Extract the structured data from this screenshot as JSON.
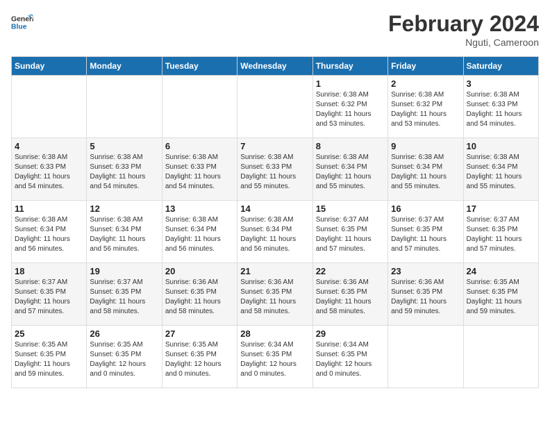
{
  "header": {
    "logo_line1": "General",
    "logo_line2": "Blue",
    "title": "February 2024",
    "subtitle": "Nguti, Cameroon"
  },
  "days_of_week": [
    "Sunday",
    "Monday",
    "Tuesday",
    "Wednesday",
    "Thursday",
    "Friday",
    "Saturday"
  ],
  "weeks": [
    [
      {
        "day": "",
        "info": ""
      },
      {
        "day": "",
        "info": ""
      },
      {
        "day": "",
        "info": ""
      },
      {
        "day": "",
        "info": ""
      },
      {
        "day": "1",
        "info": "Sunrise: 6:38 AM\nSunset: 6:32 PM\nDaylight: 11 hours\nand 53 minutes."
      },
      {
        "day": "2",
        "info": "Sunrise: 6:38 AM\nSunset: 6:32 PM\nDaylight: 11 hours\nand 53 minutes."
      },
      {
        "day": "3",
        "info": "Sunrise: 6:38 AM\nSunset: 6:33 PM\nDaylight: 11 hours\nand 54 minutes."
      }
    ],
    [
      {
        "day": "4",
        "info": "Sunrise: 6:38 AM\nSunset: 6:33 PM\nDaylight: 11 hours\nand 54 minutes."
      },
      {
        "day": "5",
        "info": "Sunrise: 6:38 AM\nSunset: 6:33 PM\nDaylight: 11 hours\nand 54 minutes."
      },
      {
        "day": "6",
        "info": "Sunrise: 6:38 AM\nSunset: 6:33 PM\nDaylight: 11 hours\nand 54 minutes."
      },
      {
        "day": "7",
        "info": "Sunrise: 6:38 AM\nSunset: 6:33 PM\nDaylight: 11 hours\nand 55 minutes."
      },
      {
        "day": "8",
        "info": "Sunrise: 6:38 AM\nSunset: 6:34 PM\nDaylight: 11 hours\nand 55 minutes."
      },
      {
        "day": "9",
        "info": "Sunrise: 6:38 AM\nSunset: 6:34 PM\nDaylight: 11 hours\nand 55 minutes."
      },
      {
        "day": "10",
        "info": "Sunrise: 6:38 AM\nSunset: 6:34 PM\nDaylight: 11 hours\nand 55 minutes."
      }
    ],
    [
      {
        "day": "11",
        "info": "Sunrise: 6:38 AM\nSunset: 6:34 PM\nDaylight: 11 hours\nand 56 minutes."
      },
      {
        "day": "12",
        "info": "Sunrise: 6:38 AM\nSunset: 6:34 PM\nDaylight: 11 hours\nand 56 minutes."
      },
      {
        "day": "13",
        "info": "Sunrise: 6:38 AM\nSunset: 6:34 PM\nDaylight: 11 hours\nand 56 minutes."
      },
      {
        "day": "14",
        "info": "Sunrise: 6:38 AM\nSunset: 6:34 PM\nDaylight: 11 hours\nand 56 minutes."
      },
      {
        "day": "15",
        "info": "Sunrise: 6:37 AM\nSunset: 6:35 PM\nDaylight: 11 hours\nand 57 minutes."
      },
      {
        "day": "16",
        "info": "Sunrise: 6:37 AM\nSunset: 6:35 PM\nDaylight: 11 hours\nand 57 minutes."
      },
      {
        "day": "17",
        "info": "Sunrise: 6:37 AM\nSunset: 6:35 PM\nDaylight: 11 hours\nand 57 minutes."
      }
    ],
    [
      {
        "day": "18",
        "info": "Sunrise: 6:37 AM\nSunset: 6:35 PM\nDaylight: 11 hours\nand 57 minutes."
      },
      {
        "day": "19",
        "info": "Sunrise: 6:37 AM\nSunset: 6:35 PM\nDaylight: 11 hours\nand 58 minutes."
      },
      {
        "day": "20",
        "info": "Sunrise: 6:36 AM\nSunset: 6:35 PM\nDaylight: 11 hours\nand 58 minutes."
      },
      {
        "day": "21",
        "info": "Sunrise: 6:36 AM\nSunset: 6:35 PM\nDaylight: 11 hours\nand 58 minutes."
      },
      {
        "day": "22",
        "info": "Sunrise: 6:36 AM\nSunset: 6:35 PM\nDaylight: 11 hours\nand 58 minutes."
      },
      {
        "day": "23",
        "info": "Sunrise: 6:36 AM\nSunset: 6:35 PM\nDaylight: 11 hours\nand 59 minutes."
      },
      {
        "day": "24",
        "info": "Sunrise: 6:35 AM\nSunset: 6:35 PM\nDaylight: 11 hours\nand 59 minutes."
      }
    ],
    [
      {
        "day": "25",
        "info": "Sunrise: 6:35 AM\nSunset: 6:35 PM\nDaylight: 11 hours\nand 59 minutes."
      },
      {
        "day": "26",
        "info": "Sunrise: 6:35 AM\nSunset: 6:35 PM\nDaylight: 12 hours\nand 0 minutes."
      },
      {
        "day": "27",
        "info": "Sunrise: 6:35 AM\nSunset: 6:35 PM\nDaylight: 12 hours\nand 0 minutes."
      },
      {
        "day": "28",
        "info": "Sunrise: 6:34 AM\nSunset: 6:35 PM\nDaylight: 12 hours\nand 0 minutes."
      },
      {
        "day": "29",
        "info": "Sunrise: 6:34 AM\nSunset: 6:35 PM\nDaylight: 12 hours\nand 0 minutes."
      },
      {
        "day": "",
        "info": ""
      },
      {
        "day": "",
        "info": ""
      }
    ]
  ]
}
